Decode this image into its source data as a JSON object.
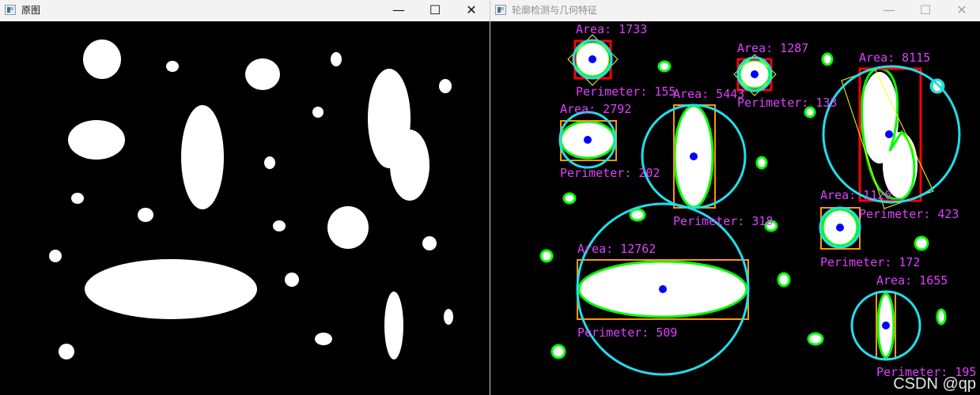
{
  "windows": {
    "left": {
      "title": "原图",
      "minimize": "—",
      "maximize": "☐",
      "close": "✕"
    },
    "right": {
      "title": "轮廓检测与几何特征",
      "minimize": "—",
      "maximize": "☐",
      "close": "✕"
    }
  },
  "colors": {
    "background": "#000000",
    "shape": "#ffffff",
    "contour": "#00ff00",
    "bounding_rect": "#ff0000",
    "ellipse_rect": "#ff9900",
    "rotated_rect": "#ffff00",
    "enclosing_circle": "#22ddee",
    "centroid": "#0000ff",
    "label_text": "#e040ff",
    "title_dim": "#8c8c8c"
  },
  "labels": {
    "area_1733": "Area: 1733",
    "perim_155": "Perimeter: 155",
    "area_1287": "Area: 1287",
    "perim_133": "Perimeter: 133",
    "area_8115": "Area: 8115",
    "perim_423": "Perimeter: 423",
    "area_2792": "Area: 2792",
    "perim_202": "Perimeter: 202",
    "area_5443": "Area: 5443",
    "perim_318": "Perimeter: 318",
    "area_1126": "Area: 1126",
    "perim_172": "Perimeter: 172",
    "area_12762": "Area: 12762",
    "perim_509": "Perimeter: 509",
    "area_1655": "Area: 1655",
    "perim_195": "Perimeter: 195"
  },
  "watermark": "CSDN @qp"
}
